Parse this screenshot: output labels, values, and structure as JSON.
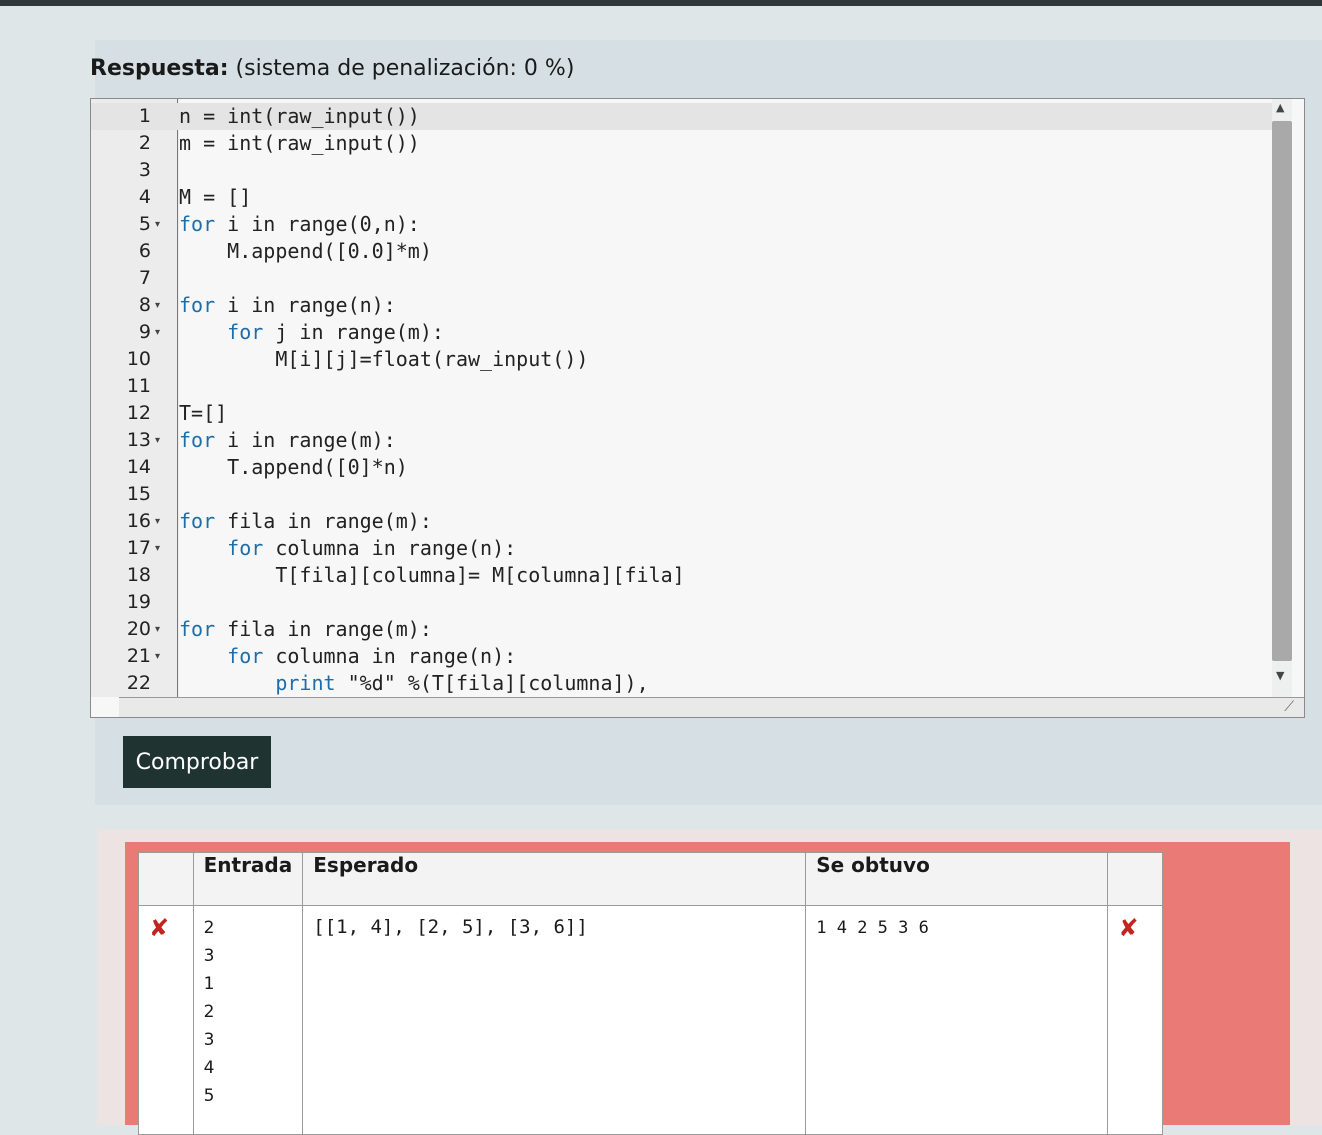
{
  "answer": {
    "label": "Respuesta:",
    "penalty": "(sistema de penalización: 0 %)"
  },
  "editor": {
    "lines": [
      {
        "num": "1",
        "fold": "",
        "indent": "",
        "kw": "",
        "text": "n = int(raw_input())"
      },
      {
        "num": "2",
        "fold": "",
        "indent": "",
        "kw": "",
        "text": "m = int(raw_input())"
      },
      {
        "num": "3",
        "fold": "",
        "indent": "",
        "kw": "",
        "text": ""
      },
      {
        "num": "4",
        "fold": "",
        "indent": "",
        "kw": "",
        "text": "M = []"
      },
      {
        "num": "5",
        "fold": "▾",
        "indent": "",
        "kw": "for",
        "text": " i in range(0,n):"
      },
      {
        "num": "6",
        "fold": "",
        "indent": "    ",
        "kw": "",
        "text": "M.append([0.0]*m)"
      },
      {
        "num": "7",
        "fold": "",
        "indent": "",
        "kw": "",
        "text": ""
      },
      {
        "num": "8",
        "fold": "▾",
        "indent": "",
        "kw": "for",
        "text": " i in range(n):"
      },
      {
        "num": "9",
        "fold": "▾",
        "indent": "    ",
        "kw": "for",
        "text": " j in range(m):"
      },
      {
        "num": "10",
        "fold": "",
        "indent": "        ",
        "kw": "",
        "text": "M[i][j]=float(raw_input())"
      },
      {
        "num": "11",
        "fold": "",
        "indent": "",
        "kw": "",
        "text": ""
      },
      {
        "num": "12",
        "fold": "",
        "indent": "",
        "kw": "",
        "text": "T=[]"
      },
      {
        "num": "13",
        "fold": "▾",
        "indent": "",
        "kw": "for",
        "text": " i in range(m):"
      },
      {
        "num": "14",
        "fold": "",
        "indent": "    ",
        "kw": "",
        "text": "T.append([0]*n)"
      },
      {
        "num": "15",
        "fold": "",
        "indent": "",
        "kw": "",
        "text": ""
      },
      {
        "num": "16",
        "fold": "▾",
        "indent": "",
        "kw": "for",
        "text": " fila in range(m):"
      },
      {
        "num": "17",
        "fold": "▾",
        "indent": "    ",
        "kw": "for",
        "text": " columna in range(n):"
      },
      {
        "num": "18",
        "fold": "",
        "indent": "        ",
        "kw": "",
        "text": "T[fila][columna]= M[columna][fila]"
      },
      {
        "num": "19",
        "fold": "",
        "indent": "",
        "kw": "",
        "text": ""
      },
      {
        "num": "20",
        "fold": "▾",
        "indent": "",
        "kw": "for",
        "text": " fila in range(m):"
      },
      {
        "num": "21",
        "fold": "▾",
        "indent": "    ",
        "kw": "for",
        "text": " columna in range(n):"
      },
      {
        "num": "22",
        "fold": "",
        "indent": "        ",
        "kw": "print",
        "text": " \"%d\" %(T[fila][columna]),"
      }
    ]
  },
  "check_button": {
    "label": "Comprobar"
  },
  "results": {
    "headers": {
      "entrada": "Entrada",
      "esperado": "Esperado",
      "obtenido": "Se obtuvo"
    },
    "rows": [
      {
        "status_icon": "✘",
        "input_lines": [
          "2",
          "3",
          "1",
          "2",
          "3",
          "4",
          "5"
        ],
        "expected": "[[1, 4], [2, 5], [3, 6]]",
        "got": "1 4 2 5 3 6",
        "result_icon": "✘"
      }
    ]
  },
  "colors": {
    "keyword": "#1d6ea8",
    "fail": "#c0261f",
    "button_bg": "#1f3431",
    "result_bg": "#ea7a76"
  }
}
